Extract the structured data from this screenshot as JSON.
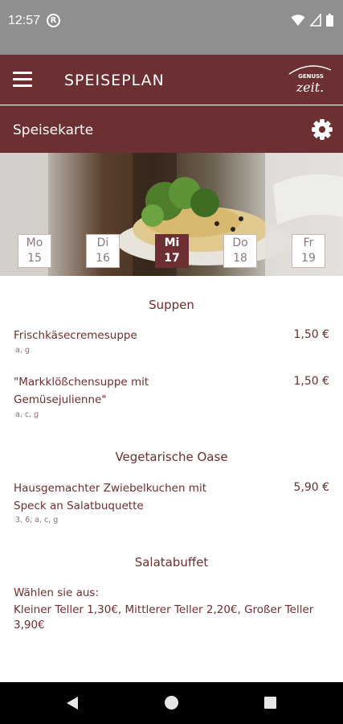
{
  "status": {
    "time": "12:57",
    "sync_glyph": "R"
  },
  "app_bar": {
    "title": "SPEISEPLAN",
    "logo_top": "GENUSS",
    "logo_bottom": "zeit."
  },
  "sub_bar": {
    "title": "Speisekarte"
  },
  "days": [
    {
      "name": "Mo",
      "date": "15",
      "selected": false
    },
    {
      "name": "Di",
      "date": "16",
      "selected": false
    },
    {
      "name": "Mi",
      "date": "17",
      "selected": true
    },
    {
      "name": "Do",
      "date": "18",
      "selected": false
    },
    {
      "name": "Fr",
      "date": "19",
      "selected": false
    }
  ],
  "menu": {
    "suppen": {
      "title": "Suppen",
      "items": [
        {
          "name": "Frischkäsecremesuppe",
          "price": "1,50 €",
          "allergens": "a, g"
        },
        {
          "name_line1": "\"Markklößchensuppe mit",
          "name_line2": "Gemüsejulienne\"",
          "price": "1,50 €",
          "allergens": "a, c, g"
        }
      ]
    },
    "vegetarisch": {
      "title": "Vegetarische Oase",
      "items": [
        {
          "name_line1": "Hausgemachter Zwiebelkuchen mit",
          "name_line2": "Speck an Salatbuquette",
          "price": "5,90 €",
          "allergens": "3, 6, a, c, g"
        }
      ]
    },
    "salat": {
      "title": "Salatabuffet",
      "line1": "Wählen sie aus:",
      "line2": "Kleiner Teller 1,30€, Mittlerer Teller 2,20€, Großer Teller",
      "line3": "3,90€"
    }
  },
  "colors": {
    "brand": "#6d3032",
    "status_bar": "#8f8f8f",
    "text": "#6b2f31"
  },
  "icons": [
    "menu-icon",
    "settings-gear-icon",
    "wifi-icon",
    "signal-icon",
    "battery-icon",
    "back-icon",
    "home-icon",
    "recents-icon"
  ]
}
